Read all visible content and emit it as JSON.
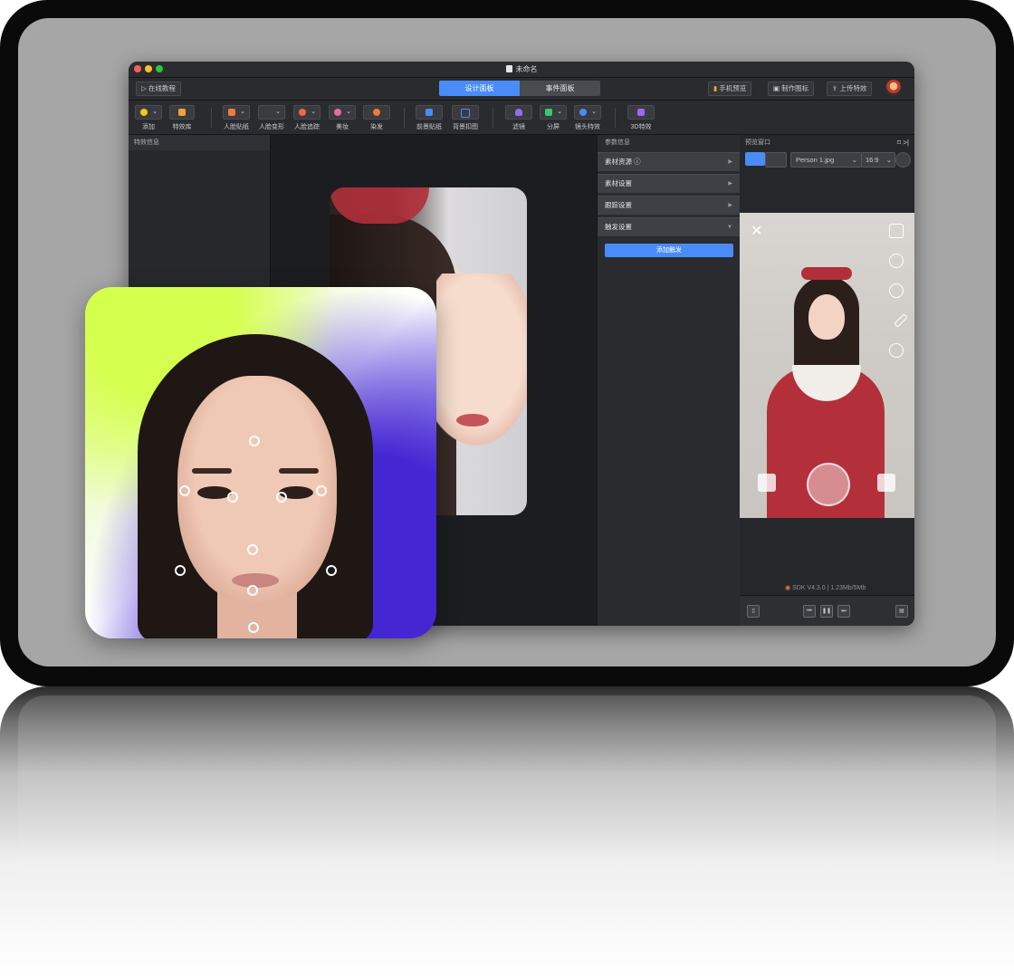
{
  "window": {
    "title": "未命名"
  },
  "topbar": {
    "tutorial": "在线教程",
    "tabs": [
      {
        "label": "设计面板",
        "active": true
      },
      {
        "label": "事件面板",
        "active": false
      }
    ],
    "phone_preview": "手机预览",
    "make_icon": "制作图标",
    "upload": "上传特效"
  },
  "toolbar": {
    "items": [
      {
        "label": "添加",
        "icon": "add-icon",
        "color": "#f5c518"
      },
      {
        "label": "特效库",
        "icon": "library-icon",
        "color": "#f0a33a"
      },
      {
        "label": "人脸贴纸",
        "icon": "face-sticker-icon",
        "color": "#f07a3a"
      },
      {
        "label": "人脸变形",
        "icon": "face-deform-icon",
        "color": "#8a8c92"
      },
      {
        "label": "人脸追踪",
        "icon": "face-track-icon",
        "color": "#f06a3a"
      },
      {
        "label": "美妆",
        "icon": "makeup-icon",
        "color": "#e86aa0"
      },
      {
        "label": "染发",
        "icon": "hair-dye-icon",
        "color": "#f07a3a"
      },
      {
        "label": "前景贴纸",
        "icon": "foreground-sticker-icon",
        "color": "#4a8cf7"
      },
      {
        "label": "背景扣图",
        "icon": "background-matting-icon",
        "color": "#4a8cf7"
      },
      {
        "label": "滤镜",
        "icon": "filter-icon",
        "color": "#9a6af0"
      },
      {
        "label": "分屏",
        "icon": "split-screen-icon",
        "color": "#3ac86a"
      },
      {
        "label": "镜头特效",
        "icon": "lens-effect-icon",
        "color": "#4a8cf7"
      },
      {
        "label": "3D特效",
        "icon": "3d-effect-icon",
        "color": "#9a6af0"
      }
    ]
  },
  "left_panel": {
    "header": "特效信息"
  },
  "param_panel": {
    "header": "参数信息",
    "sections": [
      {
        "label": "素材资源 ⓘ",
        "arrow": "▶"
      },
      {
        "label": "素材设置",
        "arrow": "▶"
      },
      {
        "label": "跟踪设置",
        "arrow": "▶"
      },
      {
        "label": "触发设置",
        "arrow": "▼"
      }
    ],
    "add_trigger": "添加触发"
  },
  "preview": {
    "header": "预览窗口",
    "header_icons": "⌑  >|",
    "image_select": "Person 1.jpg",
    "ratio_select": "16:9",
    "sdk_text": "SDK V4.3.0  |  1.23Mb/5Mb"
  },
  "colors": {
    "accent": "#4a8cf7",
    "window_bg": "#1f2023",
    "panel_bg": "#2a2b2f"
  }
}
